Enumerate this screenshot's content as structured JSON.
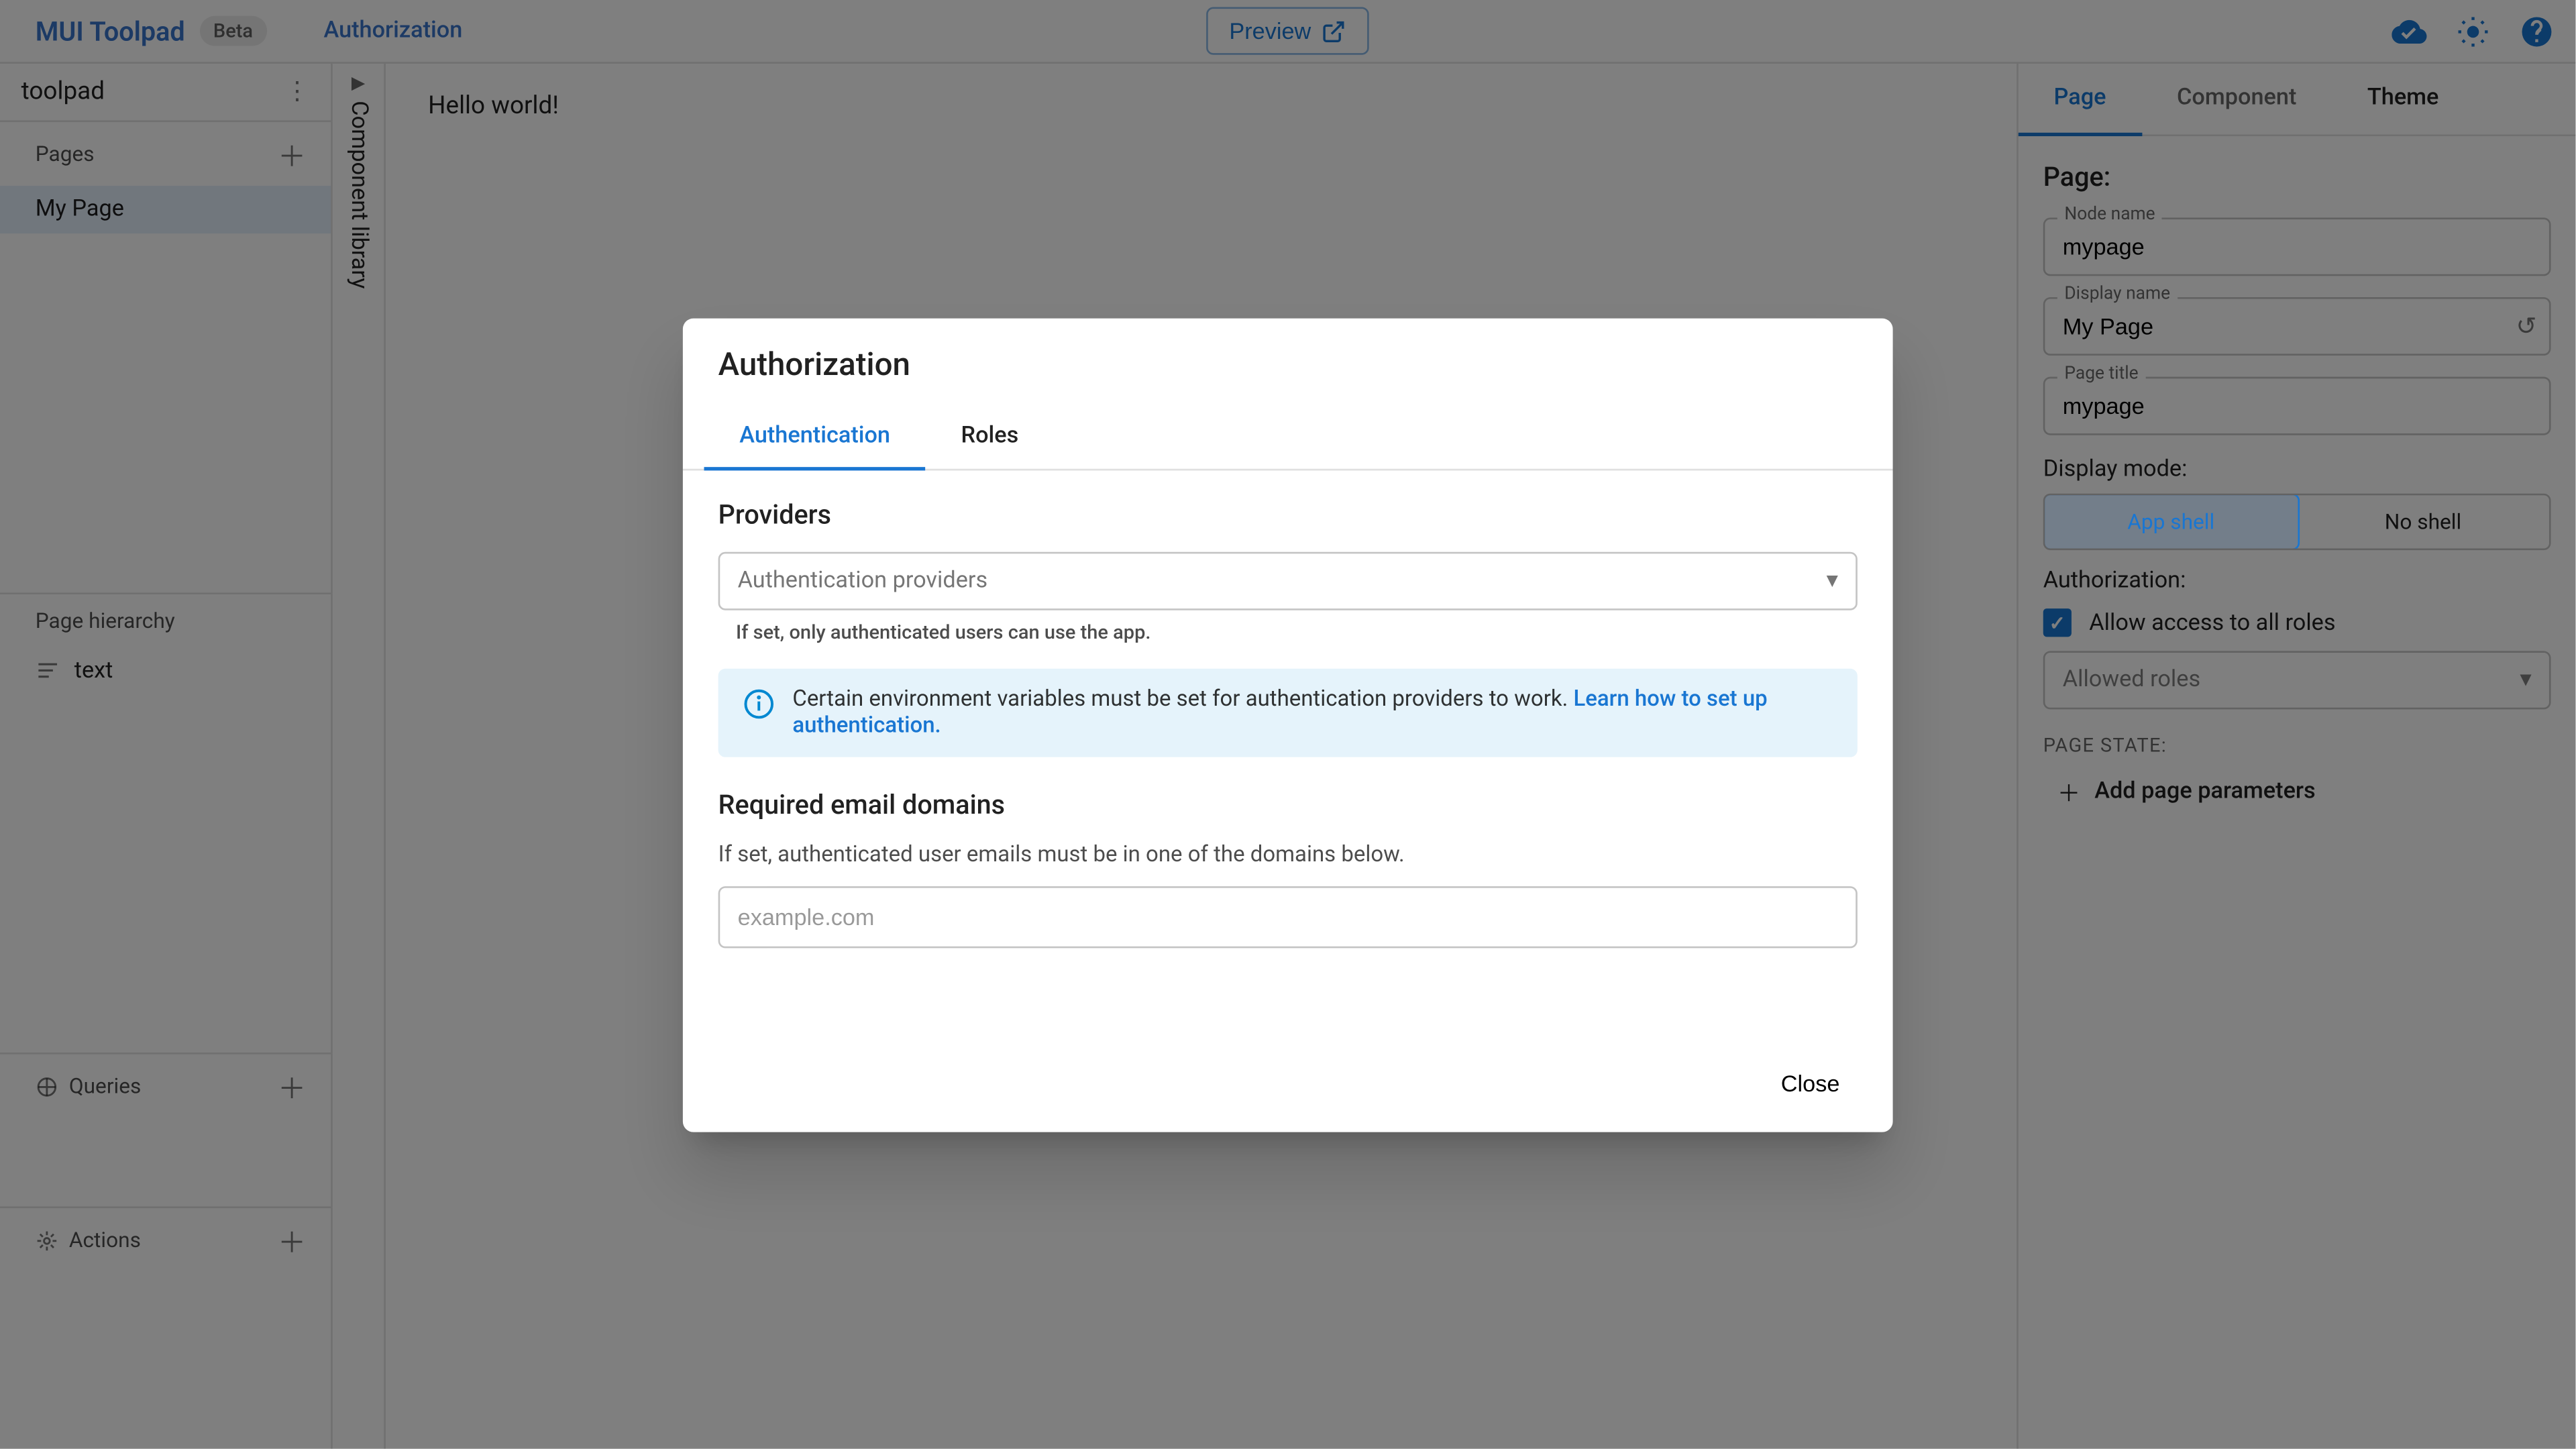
{
  "header": {
    "brand": "MUI Toolpad",
    "beta": "Beta",
    "breadcrumb": "Authorization",
    "preview": "Preview"
  },
  "leftbar": {
    "app_name": "toolpad",
    "pages_label": "Pages",
    "page_item": "My Page",
    "hierarchy_label": "Page hierarchy",
    "hier_item": "text",
    "queries_label": "Queries",
    "actions_label": "Actions"
  },
  "complib": {
    "label": "Component library"
  },
  "canvas": {
    "hello": "Hello world!"
  },
  "rightbar": {
    "tabs": {
      "page": "Page",
      "component": "Component",
      "theme": "Theme"
    },
    "heading": "Page:",
    "node_name_label": "Node name",
    "node_name_value": "mypage",
    "display_name_label": "Display name",
    "display_name_value": "My Page",
    "page_title_label": "Page title",
    "page_title_value": "mypage",
    "display_mode_label": "Display mode:",
    "app_shell": "App shell",
    "no_shell": "No shell",
    "auth_label": "Authorization:",
    "allow_all": "Allow access to all roles",
    "allowed_roles_placeholder": "Allowed roles",
    "page_state": "PAGE STATE:",
    "add_params": "Add page parameters"
  },
  "dialog": {
    "title": "Authorization",
    "tabs": {
      "auth": "Authentication",
      "roles": "Roles"
    },
    "providers_heading": "Providers",
    "providers_placeholder": "Authentication providers",
    "providers_helper": "If set, only authenticated users can use the app.",
    "alert_text": "Certain environment variables must be set for authentication providers to work. ",
    "alert_link": "Learn how to set up authentication.",
    "domains_heading": "Required email domains",
    "domains_desc": "If set, authenticated user emails must be in one of the domains below.",
    "domains_placeholder": "example.com",
    "close": "Close"
  }
}
